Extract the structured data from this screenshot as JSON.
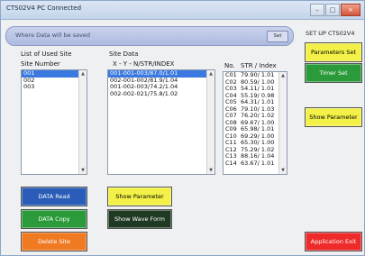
{
  "window": {
    "title": "CTS02V4 PC Connected",
    "btn_min": "–",
    "btn_max": "□",
    "btn_close": "×"
  },
  "savepath": {
    "label": "Where Data will be saved",
    "set_button": "Set"
  },
  "used_site": {
    "header": "List of Used Site",
    "subheader": "Site Number",
    "items": [
      "001",
      "002",
      "003"
    ],
    "selected": 0
  },
  "site_data": {
    "header": "Site Data",
    "subheader": "X - Y - N/STR/INDEX",
    "items": [
      "001-001-003/87.0/1.01",
      "002-001-002/81.9/1.04",
      "001-002-003/74.2/1.04",
      "002-002-021/75.8/1.02"
    ],
    "selected": 0
  },
  "strlist": {
    "col_no": "No.",
    "col_str": "STR / Index",
    "rows": [
      {
        "no": "C01",
        "val": "79.90/ 1.01"
      },
      {
        "no": "C02",
        "val": "80.59/ 1.00"
      },
      {
        "no": "C03",
        "val": "54.11/ 1.01"
      },
      {
        "no": "C04",
        "val": "55.19/ 0.98"
      },
      {
        "no": "C05",
        "val": "64.31/ 1.01"
      },
      {
        "no": "C06",
        "val": "79.10/ 1.03"
      },
      {
        "no": "C07",
        "val": "76.20/ 1.02"
      },
      {
        "no": "C08",
        "val": "69.67/ 1.00"
      },
      {
        "no": "C09",
        "val": "65.98/ 1.01"
      },
      {
        "no": "C10",
        "val": "69.29/ 1.00"
      },
      {
        "no": "C11",
        "val": "65.30/ 1.00"
      },
      {
        "no": "C12",
        "val": "75.29/ 1.02"
      },
      {
        "no": "C13",
        "val": "88.16/ 1.04"
      },
      {
        "no": "C14",
        "val": "63.67/ 1.01"
      }
    ]
  },
  "setup": {
    "label": "SET UP CTS02V4"
  },
  "buttons": {
    "parameters_set": "Parameters Set",
    "timer_set": "Timer Set",
    "show_parameter_right": "Show Parameter",
    "data_read": "DATA Read",
    "data_copy": "DATA Copy",
    "delete_site": "Delete Site",
    "show_parameter_mid": "Show Parameter",
    "show_wave_form": "Show Wave Form",
    "application_exit": "Application Exit"
  },
  "colors": {
    "yellow": "#f3f148",
    "green": "#2a9a3a",
    "blue": "#2a5cb8",
    "orange": "#f07a22",
    "red": "#ee2a2a",
    "dark": "#1f3a22"
  }
}
